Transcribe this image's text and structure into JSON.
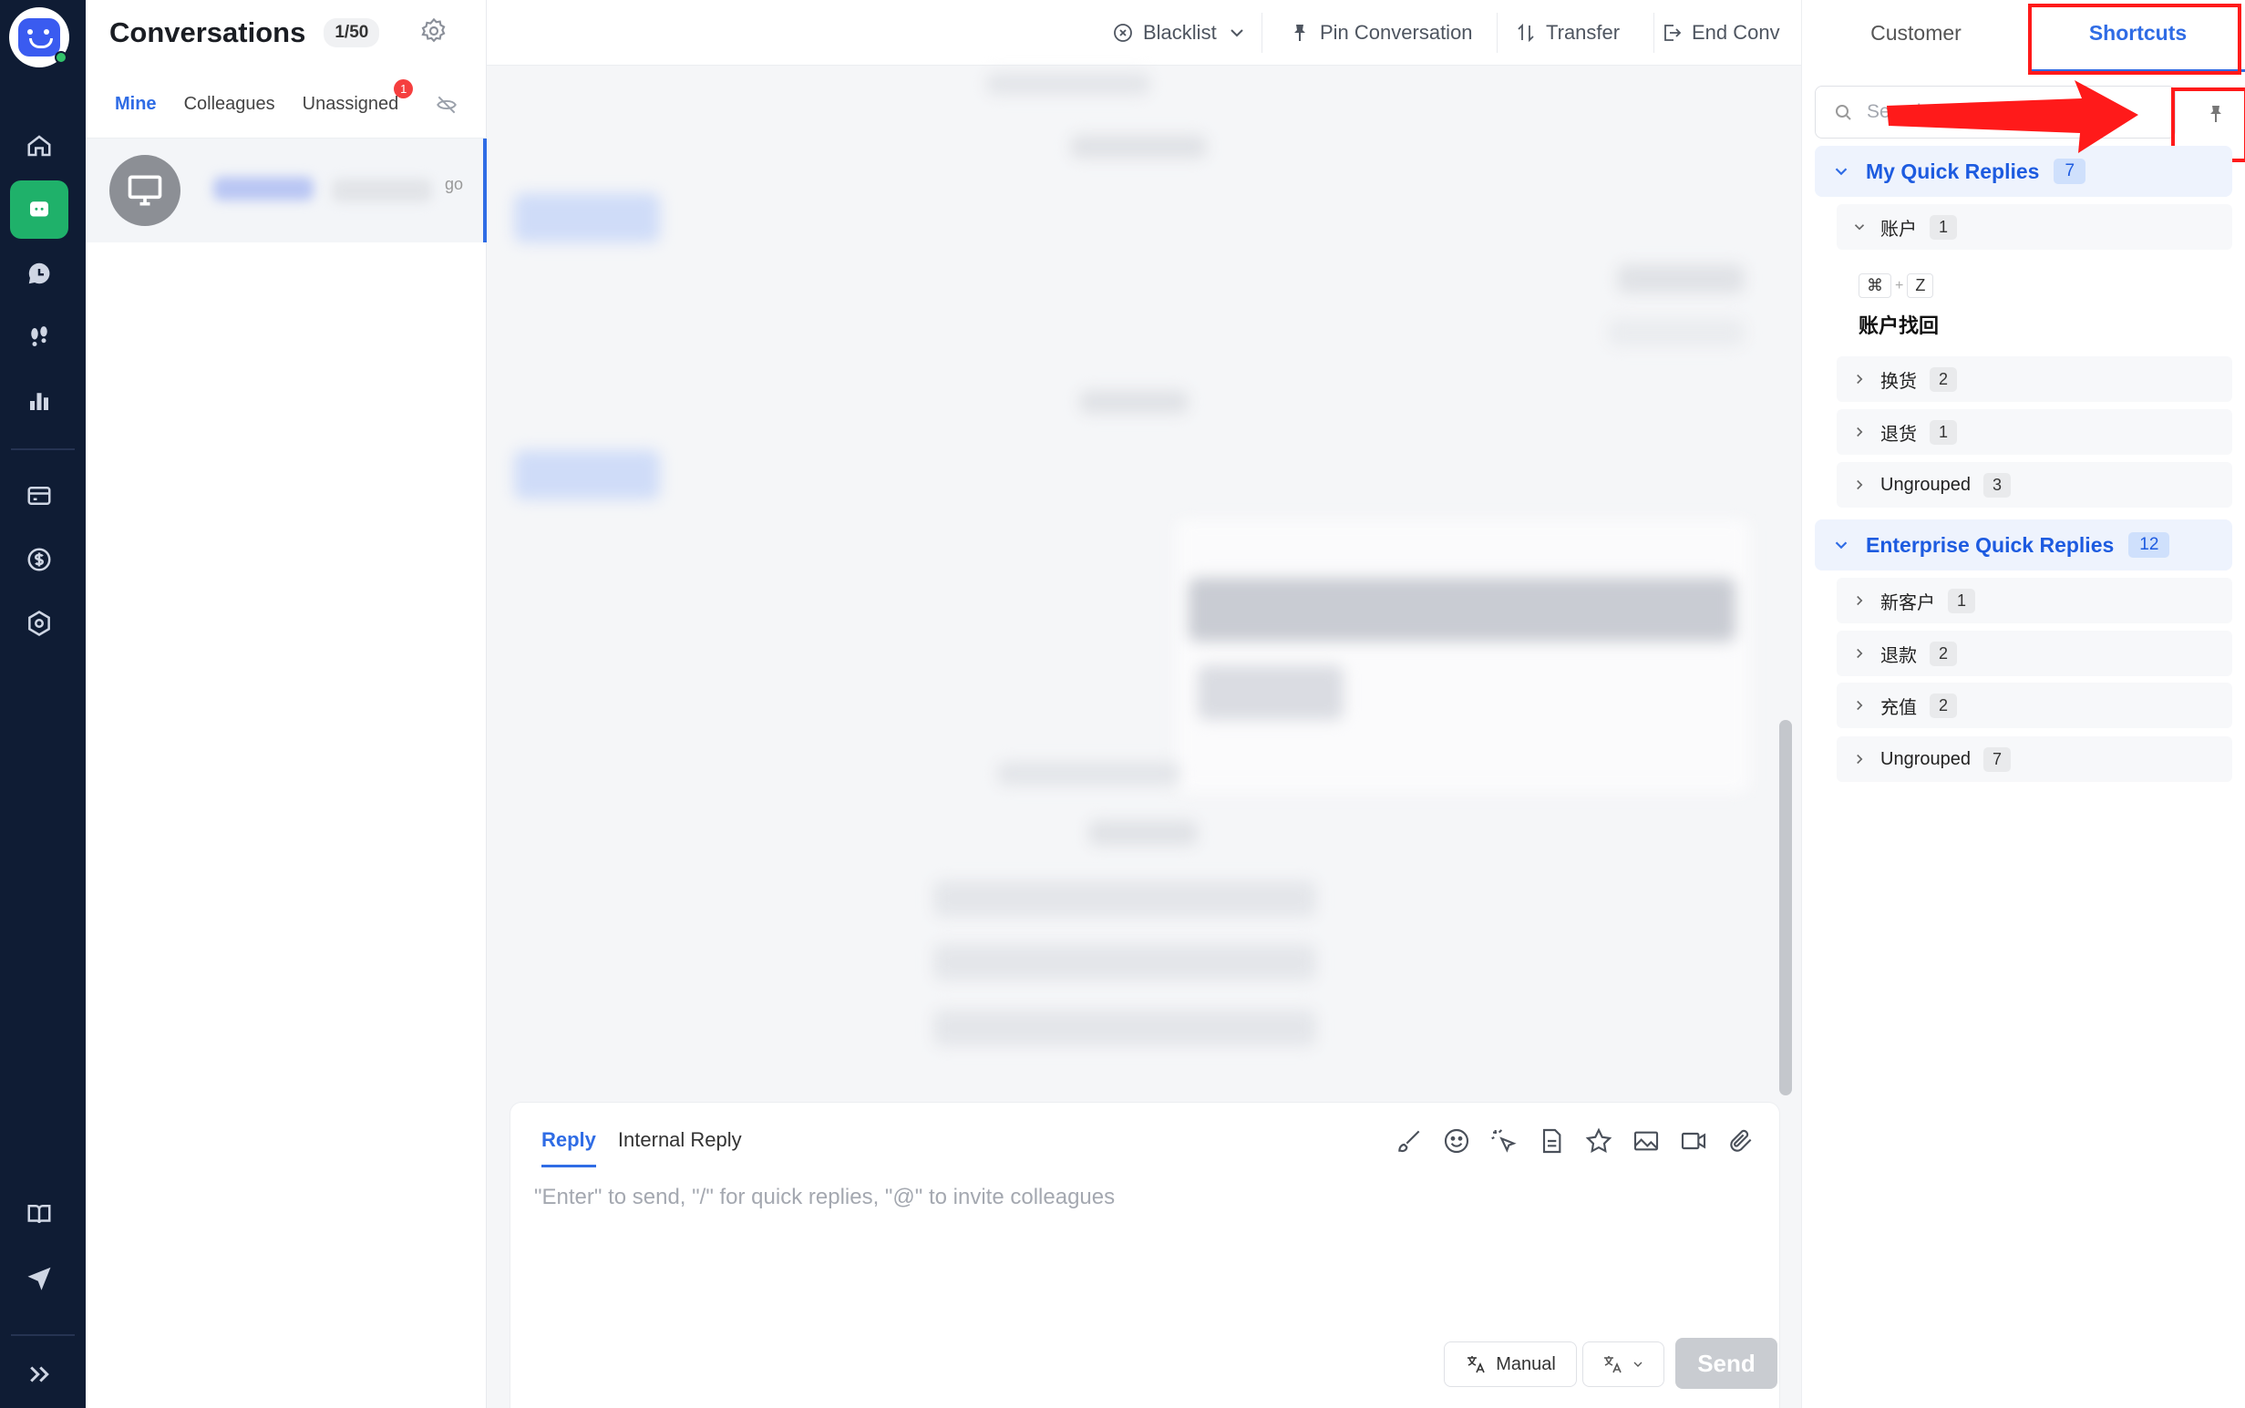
{
  "app": {
    "title": "Conversations",
    "count": "1/50"
  },
  "conv_tabs": [
    {
      "label": "Mine",
      "active": true
    },
    {
      "label": "Colleagues",
      "active": false
    },
    {
      "label": "Unassigned",
      "active": false,
      "badge": "1"
    }
  ],
  "conv_item": {
    "time": "go"
  },
  "chat_toolbar": {
    "blacklist": "Blacklist",
    "pin": "Pin Conversation",
    "transfer": "Transfer",
    "end": "End Conv"
  },
  "composer": {
    "tabs": [
      "Reply",
      "Internal Reply"
    ],
    "placeholder": "\"Enter\" to send, \"/\" for quick replies, \"@\" to invite colleagues",
    "manual_label": "Manual",
    "send_label": "Send"
  },
  "right_panel": {
    "tabs": [
      {
        "label": "Customer",
        "active": false
      },
      {
        "label": "Shortcuts",
        "active": true
      }
    ],
    "search_placeholder": "Search quick replies",
    "groups": [
      {
        "label": "My Quick Replies",
        "count": "7",
        "expanded": true,
        "subgroups": [
          {
            "label": "账户",
            "count": "1",
            "expanded": true,
            "items": [
              {
                "keys": [
                  "⌘",
                  "Z"
                ],
                "title": "账户找回"
              }
            ]
          },
          {
            "label": "换货",
            "count": "2",
            "expanded": false
          },
          {
            "label": "退货",
            "count": "1",
            "expanded": false
          },
          {
            "label": "Ungrouped",
            "count": "3",
            "expanded": false
          }
        ]
      },
      {
        "label": "Enterprise Quick Replies",
        "count": "12",
        "expanded": true,
        "subgroups": [
          {
            "label": "新客户",
            "count": "1",
            "expanded": false
          },
          {
            "label": "退款",
            "count": "2",
            "expanded": false
          },
          {
            "label": "充值",
            "count": "2",
            "expanded": false
          },
          {
            "label": "Ungrouped",
            "count": "7",
            "expanded": false
          }
        ]
      }
    ]
  },
  "colors": {
    "accent": "#2f6ce5",
    "rail_bg": "#0f1c34",
    "active_rail": "#1fb16a",
    "highlight": "#ff1a1a"
  }
}
